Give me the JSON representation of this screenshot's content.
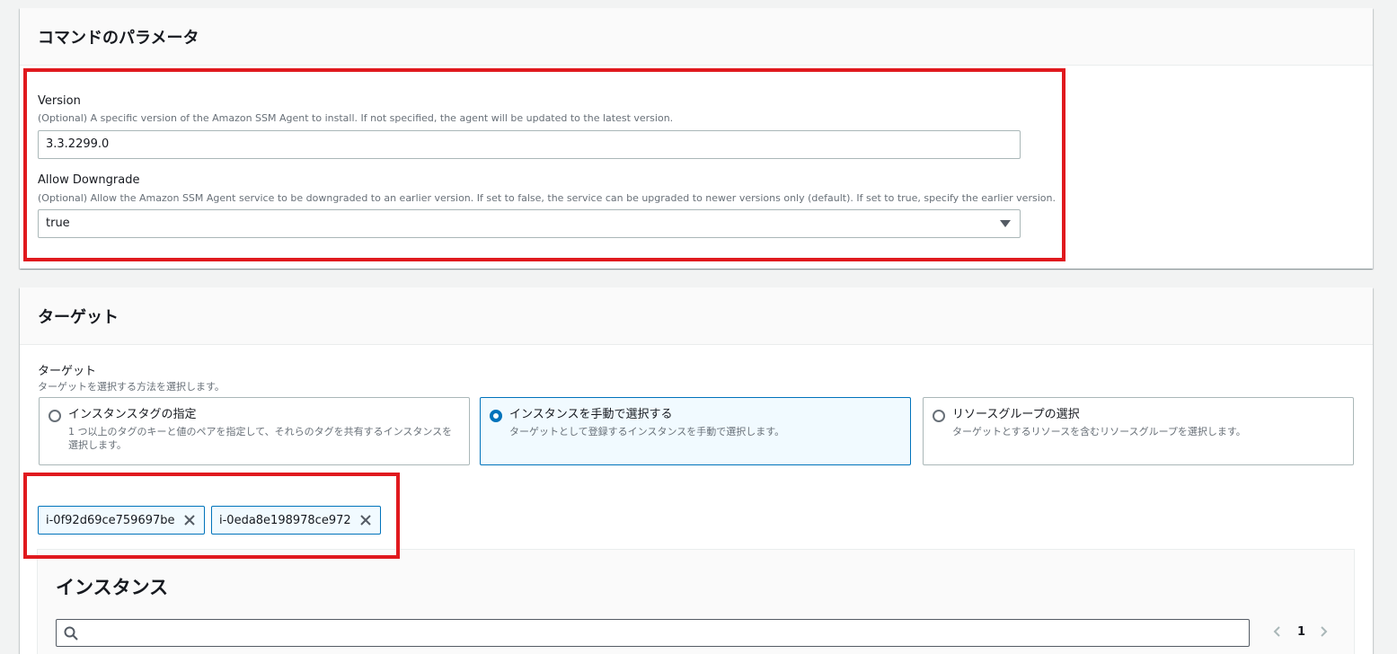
{
  "params_panel": {
    "title": "コマンドのパラメータ",
    "version": {
      "label": "Version",
      "description": "(Optional) A specific version of the Amazon SSM Agent to install. If not specified, the agent will be updated to the latest version.",
      "value": "3.3.2299.0"
    },
    "allow_downgrade": {
      "label": "Allow Downgrade",
      "description": "(Optional) Allow the Amazon SSM Agent service to be downgraded to an earlier version. If set to false, the service can be upgraded to newer versions only (default). If set to true, specify the earlier version.",
      "value": "true"
    }
  },
  "target_panel": {
    "title": "ターゲット",
    "target_label": "ターゲット",
    "target_description": "ターゲットを選択する方法を選択します。",
    "options": [
      {
        "title": "インスタンスタグの指定",
        "description": "1 つ以上のタグのキーと値のペアを指定して、それらのタグを共有するインスタンスを選択します。",
        "selected": false
      },
      {
        "title": "インスタンスを手動で選択する",
        "description": "ターゲットとして登録するインスタンスを手動で選択します。",
        "selected": true
      },
      {
        "title": "リソースグループの選択",
        "description": "ターゲットとするリソースを含むリソースグループを選択します。",
        "selected": false
      }
    ],
    "tokens": [
      "i-0f92d69ce759697be",
      "i-0eda8e198978ce972"
    ],
    "instances": {
      "title": "インスタンス",
      "search_placeholder": "",
      "current_page": "1"
    }
  },
  "colors": {
    "highlight": "#e0191e",
    "accent": "#0073bb",
    "selected_bg": "#f1faff"
  }
}
